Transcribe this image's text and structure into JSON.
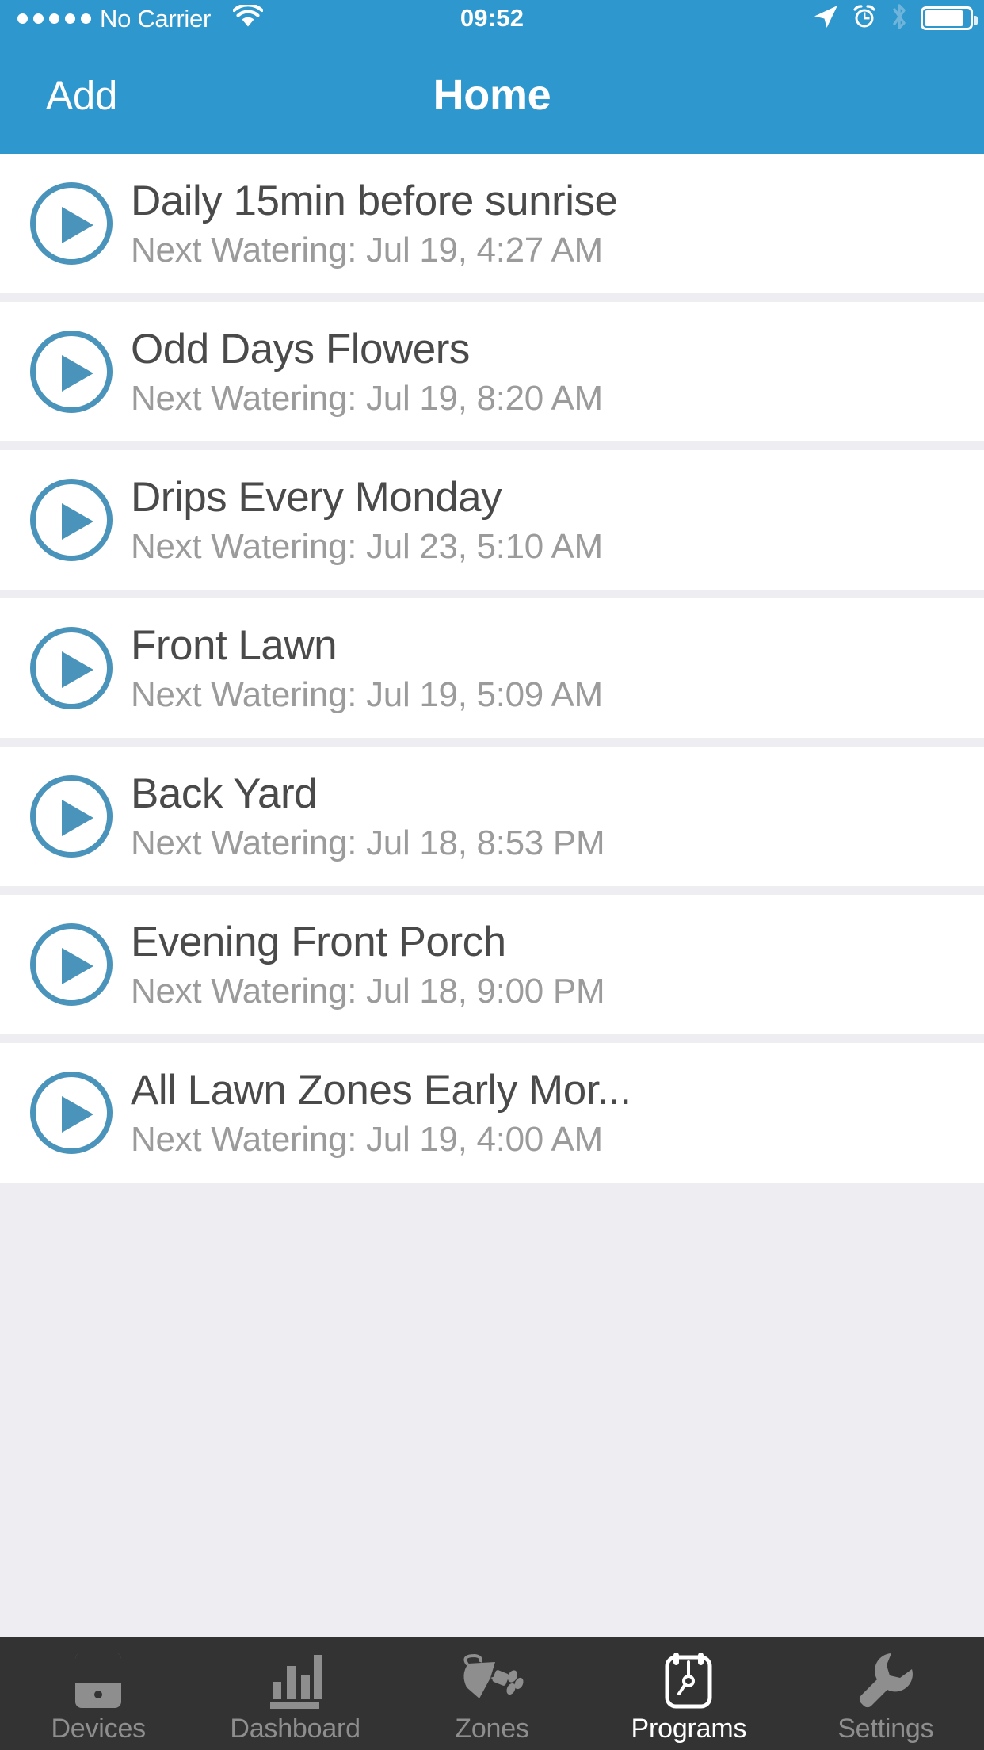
{
  "status_bar": {
    "signal_dots": 5,
    "carrier": "No Carrier",
    "wifi_icon": "wifi-icon",
    "time": "09:52",
    "location_icon": "location-arrow-icon",
    "alarm_icon": "alarm-clock-icon",
    "bluetooth_icon": "bluetooth-icon",
    "battery_icon": "battery-icon",
    "battery_level_percent": 88,
    "background_color": "#2e97cd"
  },
  "nav_bar": {
    "left_button": "Add",
    "title": "Home",
    "background_color": "#2e97cd",
    "text_color": "#ffffff"
  },
  "list": {
    "subtitle_prefix": "Next Watering: ",
    "accent_color": "#4a94bb",
    "title_color": "#4a4a4a",
    "subtitle_color": "#9b9b9b",
    "separator_color": "#eeeef2",
    "programs": [
      {
        "play_icon": "play-circle-icon",
        "title": "Daily 15min before sunrise",
        "subtitle": "Next Watering: Jul 19, 4:27 AM"
      },
      {
        "play_icon": "play-circle-icon",
        "title": "Odd Days Flowers",
        "subtitle": "Next Watering: Jul 19, 8:20 AM"
      },
      {
        "play_icon": "play-circle-icon",
        "title": "Drips Every Monday",
        "subtitle": "Next Watering: Jul 23, 5:10 AM"
      },
      {
        "play_icon": "play-circle-icon",
        "title": "Front Lawn",
        "subtitle": "Next Watering: Jul 19, 5:09 AM"
      },
      {
        "play_icon": "play-circle-icon",
        "title": "Back Yard",
        "subtitle": "Next Watering: Jul 18, 8:53 PM"
      },
      {
        "play_icon": "play-circle-icon",
        "title": "Evening Front Porch",
        "subtitle": "Next Watering: Jul 18, 9:00 PM"
      },
      {
        "play_icon": "play-circle-icon",
        "title": "All Lawn Zones Early Mor...",
        "subtitle": "Next Watering: Jul 19, 4:00 AM"
      }
    ]
  },
  "tab_bar": {
    "background_color": "#333333",
    "active_color": "#ffffff",
    "inactive_color": "#8e8e8e",
    "tabs": [
      {
        "label": "Devices",
        "icon": "device-tablet-icon",
        "active": false
      },
      {
        "label": "Dashboard",
        "icon": "bar-chart-icon",
        "active": false
      },
      {
        "label": "Zones",
        "icon": "watering-can-icon",
        "active": false
      },
      {
        "label": "Programs",
        "icon": "calendar-clock-icon",
        "active": true
      },
      {
        "label": "Settings",
        "icon": "wrench-icon",
        "active": false
      }
    ]
  }
}
